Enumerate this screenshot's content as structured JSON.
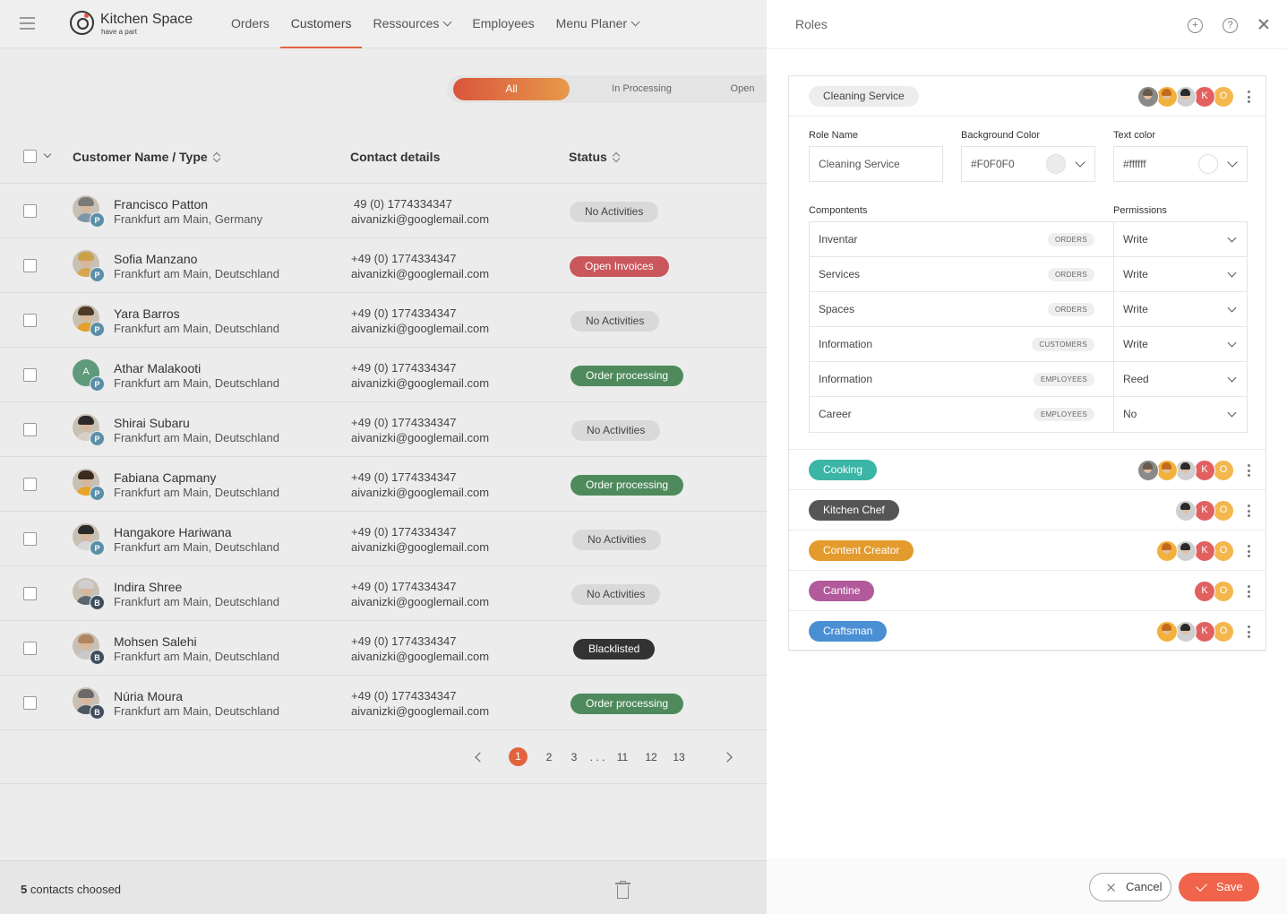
{
  "app": {
    "name": "Kitchen Space",
    "tagline": "have a part"
  },
  "nav": [
    {
      "label": "Orders",
      "dropdown": false,
      "active": false
    },
    {
      "label": "Customers",
      "dropdown": false,
      "active": true
    },
    {
      "label": "Ressources",
      "dropdown": true,
      "active": false
    },
    {
      "label": "Employees",
      "dropdown": false,
      "active": false
    },
    {
      "label": "Menu Planer",
      "dropdown": true,
      "active": false
    }
  ],
  "filters": [
    {
      "label": "All",
      "active": true
    },
    {
      "label": "In Processing",
      "active": false
    },
    {
      "label": "Open",
      "active": false
    }
  ],
  "table": {
    "columns": [
      "Customer Name / Type",
      "Contact details",
      "Status"
    ],
    "rows": [
      {
        "name": "Francisco Patton",
        "city": "Frankfurt am Main, Germany",
        "phone": "49 (0) 1774334347",
        "email": "aivanizki@googlemail.com",
        "type": "P",
        "status": "No Activities",
        "status_style": "neutral"
      },
      {
        "name": "Sofia Manzano",
        "city": "Frankfurt am Main, Deutschland",
        "phone": "+49 (0) 1774334347",
        "email": "aivanizki@googlemail.com",
        "type": "P",
        "status": "Open Invoices",
        "status_style": "danger"
      },
      {
        "name": "Yara Barros",
        "city": "Frankfurt am Main, Deutschland",
        "phone": "+49 (0) 1774334347",
        "email": "aivanizki@googlemail.com",
        "type": "P",
        "status": "No Activities",
        "status_style": "neutral"
      },
      {
        "name": "Athar Malakooti",
        "city": "Frankfurt am Main, Deutschland",
        "phone": "+49 (0) 1774334347",
        "email": "aivanizki@googlemail.com",
        "type": "P",
        "status": "Order processing",
        "status_style": "success",
        "initial": "A"
      },
      {
        "name": "Shirai Subaru",
        "city": "Frankfurt am Main, Deutschland",
        "phone": "+49 (0) 1774334347",
        "email": "aivanizki@googlemail.com",
        "type": "P",
        "status": "No Activities",
        "status_style": "neutral"
      },
      {
        "name": "Fabiana Capmany",
        "city": "Frankfurt am Main, Deutschland",
        "phone": "+49 (0) 1774334347",
        "email": "aivanizki@googlemail.com",
        "type": "P",
        "status": "Order processing",
        "status_style": "success"
      },
      {
        "name": "Hangakore Hariwana",
        "city": "Frankfurt am Main, Deutschland",
        "phone": "+49 (0) 1774334347",
        "email": "aivanizki@googlemail.com",
        "type": "P",
        "status": "No Activities",
        "status_style": "neutral"
      },
      {
        "name": "Indira Shree",
        "city": "Frankfurt am Main, Deutschland",
        "phone": "+49 (0) 1774334347",
        "email": "aivanizki@googlemail.com",
        "type": "B",
        "status": "No Activities",
        "status_style": "neutral"
      },
      {
        "name": "Mohsen Salehi",
        "city": "Frankfurt am Main, Deutschland",
        "phone": "+49 (0) 1774334347",
        "email": "aivanizki@googlemail.com",
        "type": "B",
        "status": "Blacklisted",
        "status_style": "dark"
      },
      {
        "name": "Núria Moura",
        "city": "Frankfurt am Main, Deutschland",
        "phone": "+49 (0) 1774334347",
        "email": "aivanizki@googlemail.com",
        "type": "B",
        "status": "Order processing",
        "status_style": "success"
      }
    ]
  },
  "pagination": {
    "pages": [
      "1",
      "2",
      "3",
      ". . .",
      "11",
      "12",
      "13"
    ],
    "current": "1"
  },
  "footer": {
    "count": "5",
    "label": "contacts choosed"
  },
  "panel": {
    "title": "Roles",
    "fields": {
      "role_name_label": "Role Name",
      "role_name_value": "Cleaning Service",
      "bg_color_label": "Background Color",
      "bg_color_value": "#F0F0F0",
      "text_color_label": "Text color",
      "text_color_value": "#ffffff",
      "components_label": "Compontents",
      "permissions_label": "Permissions"
    },
    "components": [
      {
        "name": "Inventar",
        "tag": "ORDERS",
        "permission": "Write"
      },
      {
        "name": "Services",
        "tag": "ORDERS",
        "permission": "Write"
      },
      {
        "name": "Spaces",
        "tag": "ORDERS",
        "permission": "Write"
      },
      {
        "name": "Information",
        "tag": "CUSTOMERS",
        "permission": "Write"
      },
      {
        "name": "Information",
        "tag": "EMPLOYEES",
        "permission": "Reed"
      },
      {
        "name": "Career",
        "tag": "EMPLOYEES",
        "permission": "No"
      }
    ],
    "roles": [
      {
        "label": "Cleaning Service",
        "bg": "#F0F0F0",
        "color": "#444444",
        "avatars": [
          "photo-1",
          "photo-2",
          "photo-3",
          "K",
          "O"
        ]
      },
      {
        "label": "Cooking",
        "bg": "#3BB5A6",
        "color": "#ffffff",
        "avatars": [
          "photo-1",
          "photo-2",
          "photo-3",
          "K",
          "O"
        ]
      },
      {
        "label": "Kitchen Chef",
        "bg": "#555555",
        "color": "#ffffff",
        "avatars": [
          "photo-3",
          "K",
          "O"
        ]
      },
      {
        "label": "Content Creator",
        "bg": "#E39B2E",
        "color": "#ffffff",
        "avatars": [
          "photo-2",
          "photo-3",
          "K",
          "O"
        ]
      },
      {
        "label": "Cantine",
        "bg": "#B25A9C",
        "color": "#ffffff",
        "avatars": [
          "K",
          "O"
        ]
      },
      {
        "label": "Craftsman",
        "bg": "#4A8FD4",
        "color": "#ffffff",
        "avatars": [
          "photo-2",
          "photo-3",
          "K",
          "O"
        ]
      }
    ],
    "cancel_label": "Cancel",
    "save_label": "Save"
  },
  "colors": {
    "accent": "#E2643F",
    "save": "#F0644B",
    "success": "#4E8A5C",
    "danger": "#C9575B",
    "dark": "#333333",
    "avatar_k": "#E26060",
    "avatar_o": "#F3B74E",
    "type_p": "#5A8FA8",
    "type_b": "#3F4E5E"
  }
}
